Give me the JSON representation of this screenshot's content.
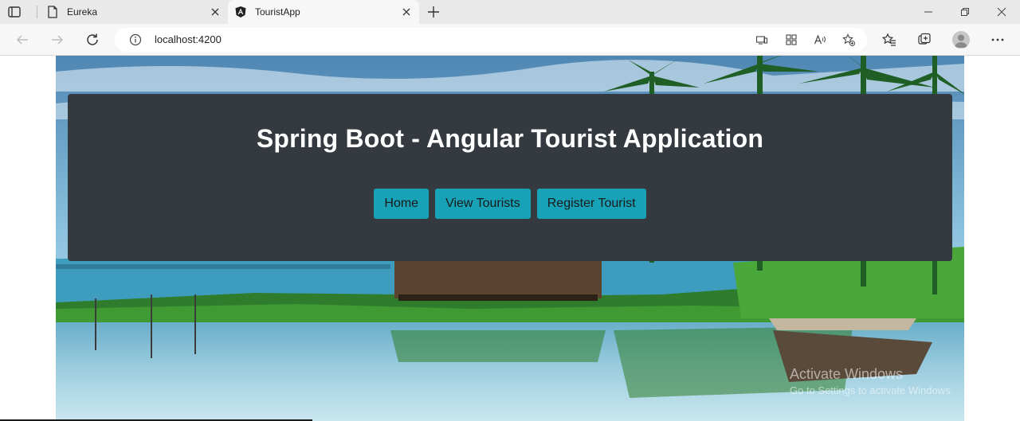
{
  "browser": {
    "tabs": [
      {
        "title": "Eureka",
        "favicon": "page-icon"
      },
      {
        "title": "TouristApp",
        "favicon": "angular-icon"
      }
    ],
    "address": "localhost:4200"
  },
  "app": {
    "heading": "Spring Boot - Angular Tourist Application",
    "nav": {
      "home": "Home",
      "view": "View Tourists",
      "register": "Register Tourist"
    },
    "colors": {
      "jumbotron": "#343a40",
      "button": "#17a2b8"
    }
  },
  "watermark": {
    "line1": "Activate Windows",
    "line2": "Go to Settings to activate Windows."
  }
}
